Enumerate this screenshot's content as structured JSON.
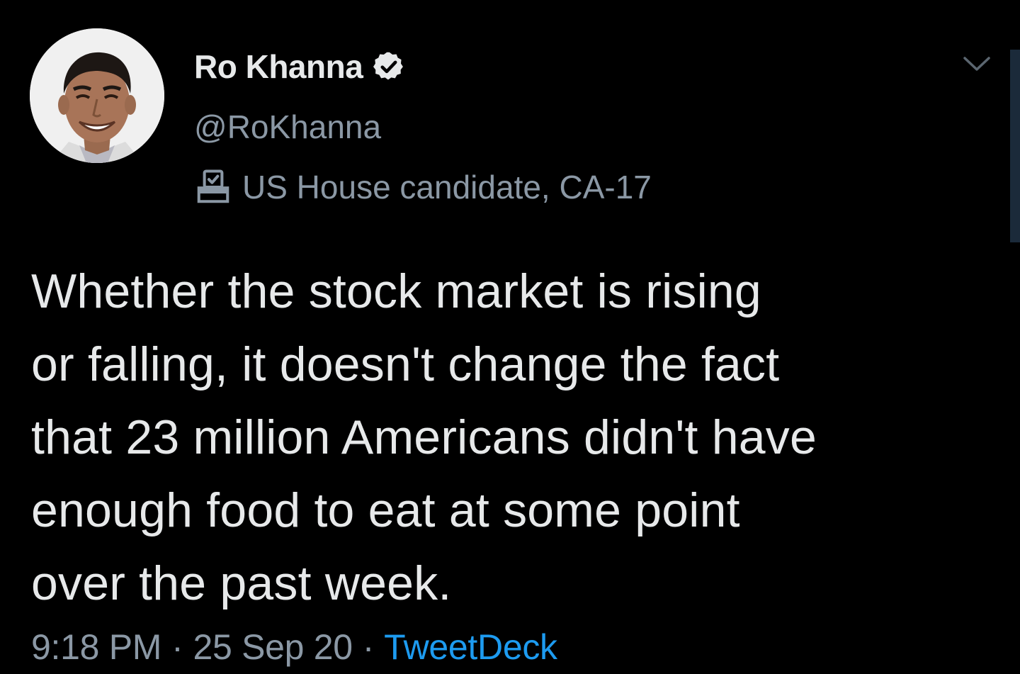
{
  "author": {
    "display_name": "Ro Khanna",
    "handle": "@RoKhanna",
    "label": "US House candidate, CA-17",
    "verified": true
  },
  "tweet": {
    "text": "Whether the stock market is rising\nor falling, it doesn't change the fact\nthat 23 million Americans didn't have\nenough food to eat at some point\nover the past week."
  },
  "meta": {
    "time": "9:18 PM",
    "separator": "·",
    "date": "25 Sep 20",
    "source": "TweetDeck"
  },
  "icons": {
    "verified": "verified-badge-icon",
    "label": "ballot-box-icon",
    "menu": "chevron-down-icon"
  },
  "colors": {
    "background": "#000000",
    "primary_text": "#e7e9ea",
    "secondary_text": "#8b98a5",
    "link": "#1d9bf0"
  }
}
